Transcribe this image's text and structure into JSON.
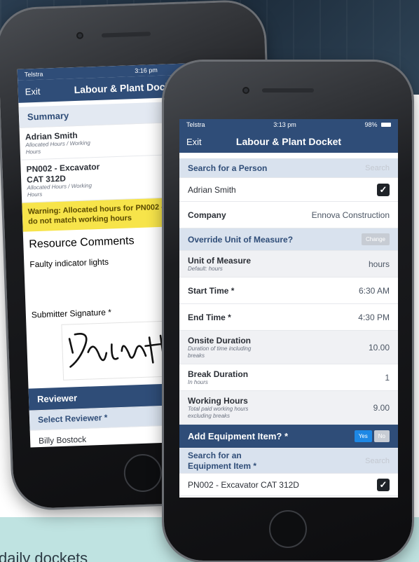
{
  "caption": "daily dockets",
  "back": {
    "status": {
      "carrier": "Telstra",
      "time": "3:16 pm"
    },
    "nav": {
      "exit": "Exit",
      "title": "Labour & Plant Docket"
    },
    "summary": {
      "header": "Summary",
      "person": "Adrian Smith",
      "person_sub": "Allocated Hours / Working Hours",
      "equipment": "PN002 - Excavator CAT 312D",
      "equipment_sub": "Allocated Hours / Working Hours",
      "warning": "Warning: Allocated hours for PN002 - Excavator CAT 312D do not match working hours",
      "comments_label": "Resource Comments",
      "comments_value": "Faulty indicator lights",
      "signature_label": "Submitter Signature *"
    },
    "reviewer": {
      "header": "Reviewer",
      "select_label": "Select Reviewer *",
      "value": "Billy Bostock"
    }
  },
  "front": {
    "status": {
      "carrier": "Telstra",
      "time": "3:13 pm",
      "battery": "98%"
    },
    "nav": {
      "exit": "Exit",
      "title": "Labour & Plant Docket"
    },
    "search_person": {
      "label": "Search for a Person",
      "placeholder": "Search"
    },
    "person": "Adrian Smith",
    "company": {
      "label": "Company",
      "value": "Ennova Construction"
    },
    "override": {
      "label": "Override Unit of Measure?",
      "button": "Change"
    },
    "unit": {
      "label": "Unit of Measure",
      "sub": "Default: hours",
      "value": "hours"
    },
    "start": {
      "label": "Start Time *",
      "value": "6:30 AM"
    },
    "end": {
      "label": "End Time *",
      "value": "4:30 PM"
    },
    "onsite": {
      "label": "Onsite Duration",
      "sub": "Duration of time including breaks",
      "value": "10.00"
    },
    "break": {
      "label": "Break Duration",
      "sub": "In hours",
      "value": "1"
    },
    "working": {
      "label": "Working Hours",
      "sub": "Total paid working hours excluding breaks",
      "value": "9.00"
    },
    "add_equipment": {
      "label": "Add Equipment Item? *",
      "yes": "Yes",
      "no": "No"
    },
    "search_equipment": {
      "label": "Search for an Equipment Item *",
      "placeholder": "Search"
    },
    "equipment": "PN002 - Excavator CAT 312D"
  },
  "colors": {
    "nav": "#2f4d78",
    "warning": "#f7e44a",
    "yes": "#1e88e5",
    "bottom_band": "#bfe3e1"
  }
}
